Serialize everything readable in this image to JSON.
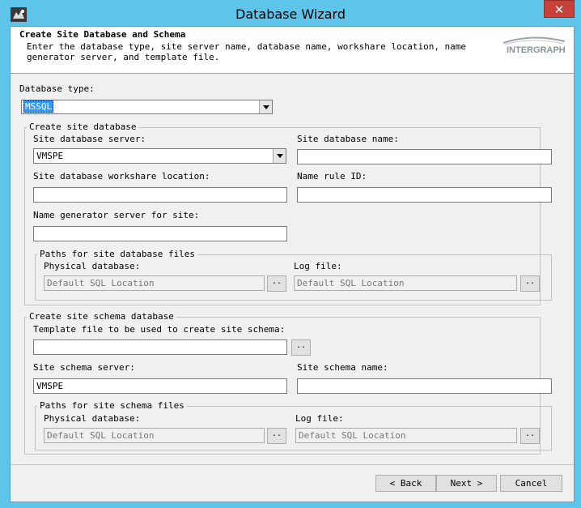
{
  "window": {
    "title": "Database Wizard",
    "close_symbol": "✕"
  },
  "header": {
    "title": "Create Site Database and Schema",
    "description": "Enter the database type, site server name, database name, workshare location, name generator server, and template file.",
    "logo_text": "INTERGRAPH"
  },
  "db_type": {
    "label": "Database type:",
    "value": "MSSQL"
  },
  "site_db": {
    "group_title": "Create site database",
    "server_label": "Site database server:",
    "server_value": "VMSPE",
    "name_label": "Site database name:",
    "name_value": "",
    "workshare_label": "Site database workshare location:",
    "workshare_value": "",
    "name_rule_label": "Name rule ID:",
    "name_rule_value": "",
    "name_gen_label": "Name generator server for site:",
    "name_gen_value": "",
    "paths": {
      "group_title": "Paths for site database files",
      "physical_label": "Physical database:",
      "physical_placeholder": "Default SQL Location",
      "log_label": "Log file:",
      "log_placeholder": "Default SQL Location"
    }
  },
  "schema_db": {
    "group_title": "Create site schema database",
    "template_label": "Template file to be used to create site schema:",
    "template_value": "",
    "server_label": "Site schema server:",
    "server_value": "VMSPE",
    "name_label": "Site schema name:",
    "name_value": "",
    "paths": {
      "group_title": "Paths for site schema files",
      "physical_label": "Physical database:",
      "physical_placeholder": "Default SQL Location",
      "log_label": "Log file:",
      "log_placeholder": "Default SQL Location"
    }
  },
  "buttons": {
    "browse": "..",
    "back": "< Back",
    "next": "Next >",
    "cancel": "Cancel"
  }
}
